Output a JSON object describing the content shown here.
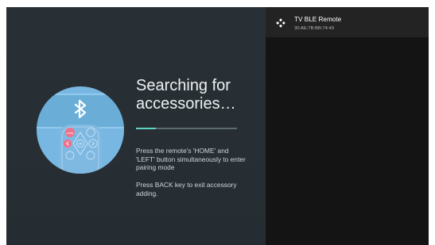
{
  "screen": {
    "title": "Searching for accessories…",
    "progress_fraction": 0.2,
    "instructions": [
      "Press the remote's 'HOME' and 'LEFT' button simultaneously to enter pairing mode",
      "Press BACK key to exit accessory adding."
    ]
  },
  "devices": [
    {
      "name": "TV BLE Remote",
      "address": "30:AE:7B:BB:74:49",
      "icon": "gamepad-icon"
    }
  ],
  "illustration": {
    "icon": "bluetooth-icon",
    "remote_center_label": "OK"
  },
  "colors": {
    "background": "#272e33",
    "right_panel": "#141414",
    "accent": "#5fd4c2",
    "illustration_circle": "#78b7e2",
    "remote_home_button": "#f0708a"
  }
}
